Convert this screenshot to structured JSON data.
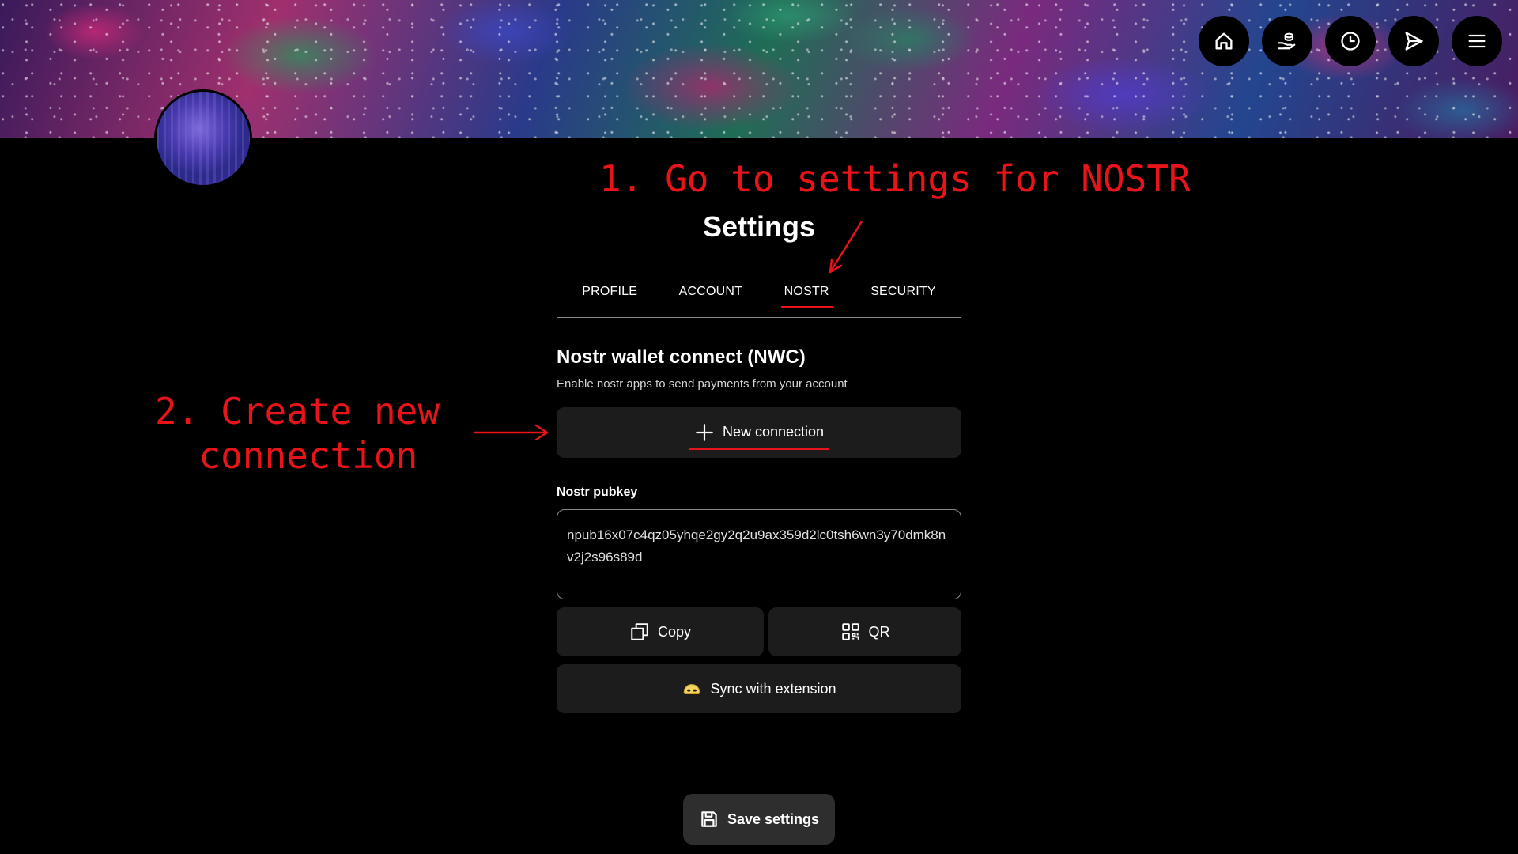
{
  "header": {
    "nav": [
      {
        "name": "home",
        "icon": "home-icon"
      },
      {
        "name": "receive",
        "icon": "hand-coins-icon"
      },
      {
        "name": "history",
        "icon": "clock-icon"
      },
      {
        "name": "send",
        "icon": "send-icon"
      },
      {
        "name": "menu",
        "icon": "hamburger-menu-icon"
      }
    ]
  },
  "annotations": {
    "step1": "1. Go to settings for NOSTR",
    "step2": "2. Create new\n connection",
    "color": "#e8141a"
  },
  "settings": {
    "title": "Settings",
    "tabs": [
      {
        "label": "PROFILE",
        "active": false
      },
      {
        "label": "ACCOUNT",
        "active": false
      },
      {
        "label": "NOSTR",
        "active": true
      },
      {
        "label": "SECURITY",
        "active": false
      }
    ]
  },
  "nwc": {
    "title": "Nostr wallet connect (NWC)",
    "description": "Enable nostr apps to send payments from your account",
    "new_connection_label": "New connection"
  },
  "pubkey": {
    "label": "Nostr pubkey",
    "value": "npub16x07c4qz05yhqe2gy2q2u9ax359d2lc0tsh6wn3y70dmk8nv2j2s96s89d",
    "copy_label": "Copy",
    "qr_label": "QR",
    "sync_label": "Sync with extension"
  },
  "footer": {
    "save_label": "Save settings"
  }
}
